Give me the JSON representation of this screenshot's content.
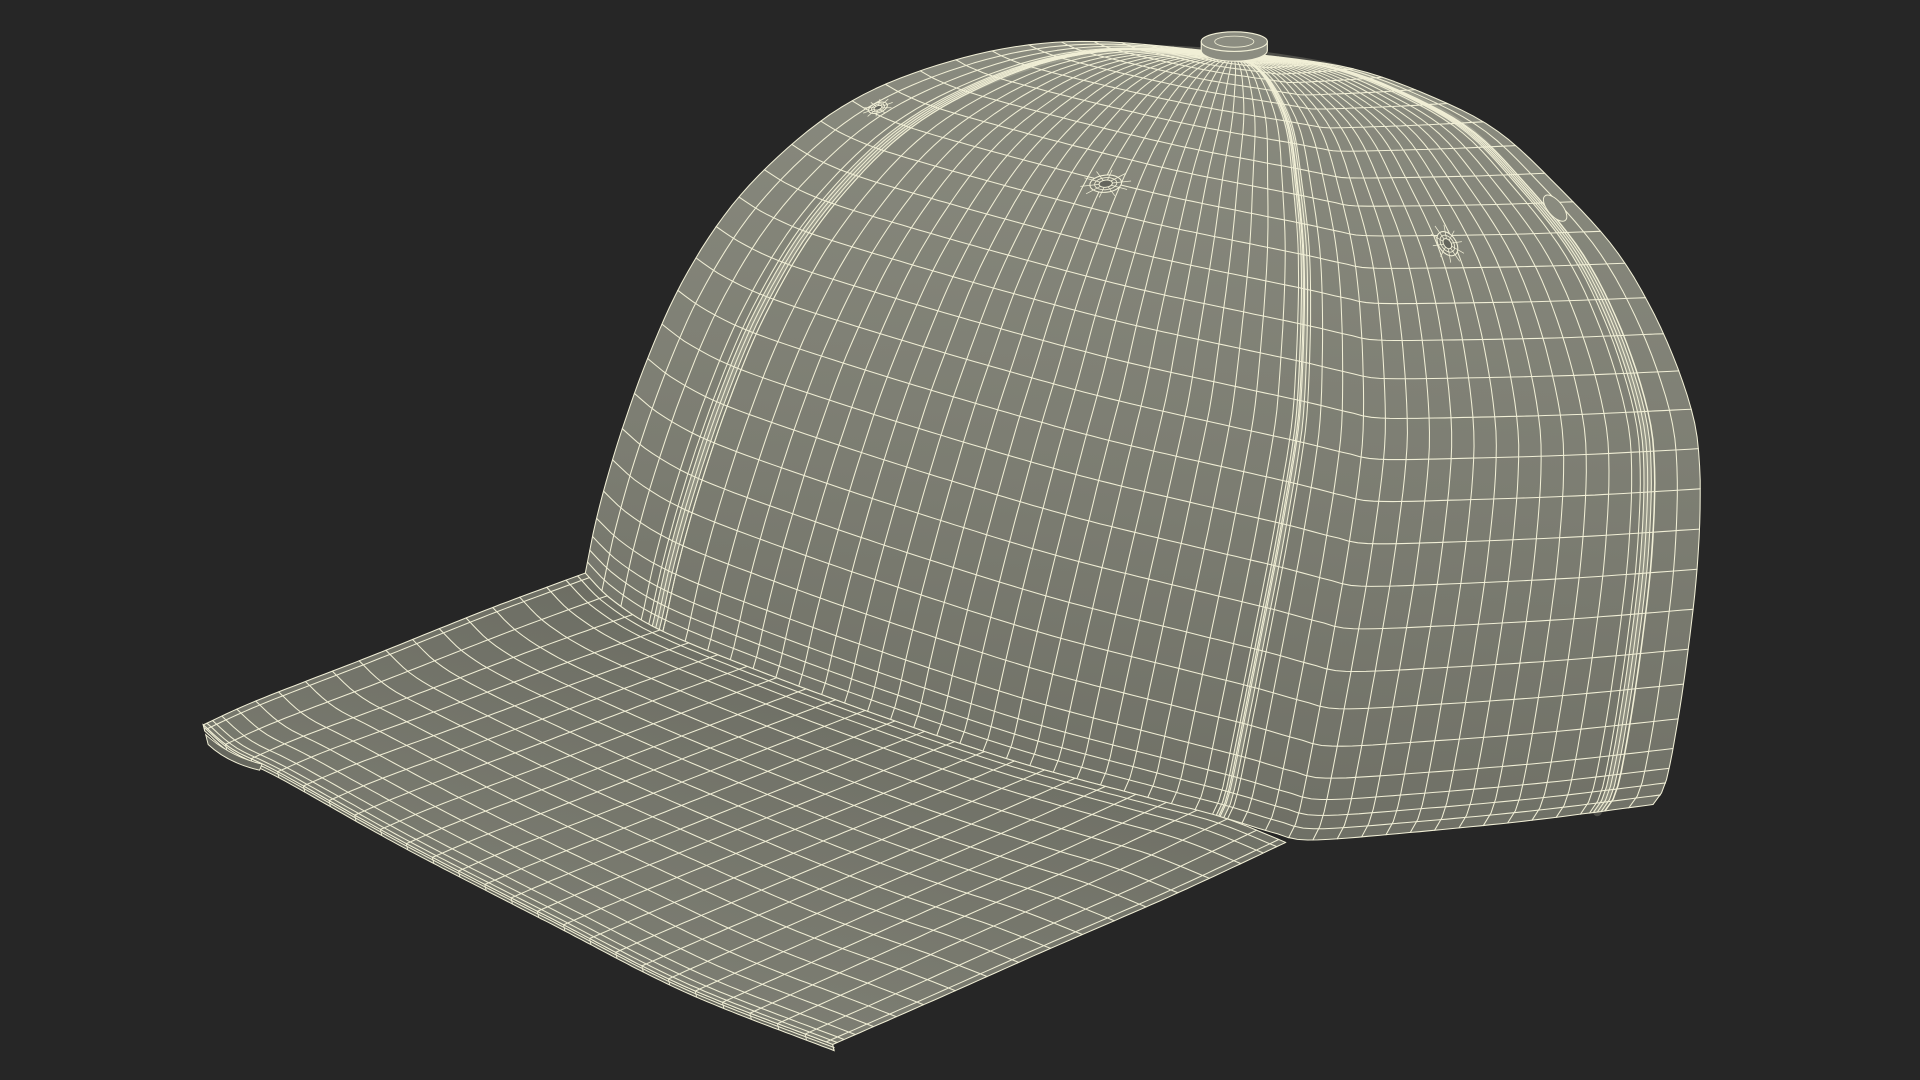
{
  "colors": {
    "background": "#262626",
    "crown_top": "#8a8b7f",
    "crown_mid": "#7c7d72",
    "crown_bottom": "#6e6f65",
    "brim_near": "#6b6c62",
    "brim_far": "#7e7f74",
    "rim": "#66675e",
    "button": "#8c8d81",
    "eyelet_hole": "#65665d",
    "wireframe": "#f1efd6"
  }
}
